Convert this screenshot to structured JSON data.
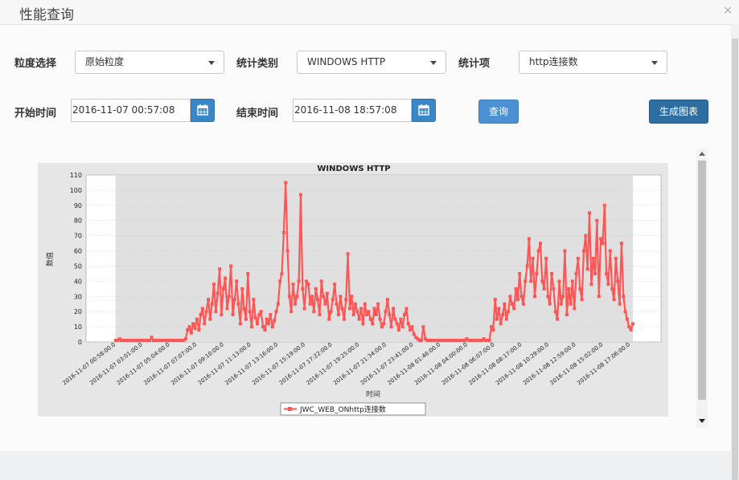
{
  "dialog": {
    "title": "性能查询",
    "close_glyph": "×"
  },
  "form": {
    "granularity_label": "粒度选择",
    "granularity_value": "原始粒度",
    "category_label": "统计类别",
    "category_value": "WINDOWS HTTP",
    "item_label": "统计项",
    "item_value": "http连接数",
    "start_label": "开始时间",
    "start_value": "2016-11-07 00:57:08",
    "end_label": "结束时间",
    "end_value": "2016-11-08 18:57:08",
    "query_button": "查询",
    "generate_button": "生成图表"
  },
  "icons": {
    "calendar": "calendar-icon",
    "dropdown": "chevron-down-icon",
    "close": "close-icon"
  },
  "colors": {
    "series": "#ff5555",
    "button_primary": "#4a90d2",
    "button_dark": "#2f6ea3",
    "calendar_button": "#3a87c8"
  },
  "chart_data": {
    "type": "line",
    "title": "WINDOWS HTTP",
    "xlabel": "时间",
    "ylabel": "数值",
    "ylim": [
      0,
      110
    ],
    "yticks": [
      0,
      10,
      20,
      30,
      40,
      50,
      60,
      70,
      80,
      90,
      100,
      110
    ],
    "xticks": [
      "2016-11-07 00:58:00.0",
      "2016-11-07 03:01:00.0",
      "2016-11-07 05:04:00.0",
      "2016-11-07 07:07:00.0",
      "2016-11-07 09:10:00.0",
      "2016-11-07 11:13:00.0",
      "2016-11-07 13:16:00.0",
      "2016-11-07 15:19:00.0",
      "2016-11-07 17:22:00.0",
      "2016-11-07 19:25:00.0",
      "2016-11-07 21:34:00.0",
      "2016-11-07 23:41:00.0",
      "2016-11-08 01:46:00.0",
      "2016-11-08 04:00:00.0",
      "2016-11-08 06:07:00.0",
      "2016-11-08 08:17:00.0",
      "2016-11-08 10:29:00.0",
      "2016-11-08 12:59:00.0",
      "2016-11-08 15:02:00.0",
      "2016-11-08 17:06:00.0"
    ],
    "grid": true,
    "legend_position": "bottom-center",
    "series": [
      {
        "name": "JWC_WEB_ONhttp连接数",
        "color": "#ff5555",
        "values": [
          1,
          1,
          2,
          1,
          1,
          1,
          1,
          1,
          1,
          1,
          1,
          1,
          1,
          1,
          1,
          1,
          1,
          1,
          1,
          3,
          1,
          1,
          1,
          1,
          1,
          1,
          1,
          1,
          1,
          1,
          1,
          1,
          1,
          1,
          1,
          1,
          1,
          2,
          8,
          10,
          6,
          12,
          9,
          15,
          8,
          18,
          22,
          12,
          20,
          28,
          15,
          25,
          38,
          20,
          32,
          48,
          18,
          35,
          42,
          22,
          30,
          50,
          18,
          28,
          40,
          25,
          12,
          35,
          22,
          15,
          45,
          20,
          10,
          28,
          16,
          12,
          18,
          20,
          10,
          8,
          15,
          12,
          18,
          10,
          14,
          20,
          25,
          40,
          45,
          72,
          105,
          60,
          30,
          20,
          38,
          25,
          30,
          40,
          97,
          35,
          22,
          40,
          38,
          25,
          30,
          20,
          35,
          28,
          18,
          40,
          30,
          25,
          32,
          15,
          20,
          28,
          38,
          25,
          18,
          30,
          22,
          15,
          28,
          58,
          22,
          30,
          18,
          25,
          20,
          15,
          22,
          12,
          25,
          18,
          20,
          15,
          12,
          22,
          18,
          25,
          15,
          10,
          12,
          20,
          28,
          18,
          10,
          22,
          15,
          12,
          8,
          15,
          10,
          18,
          22,
          12,
          8,
          10,
          5,
          3,
          2,
          1,
          1,
          10,
          2,
          1,
          1,
          1,
          1,
          1,
          1,
          1,
          1,
          1,
          1,
          1,
          1,
          1,
          1,
          1,
          1,
          1,
          1,
          1,
          1,
          1,
          2,
          1,
          1,
          1,
          1,
          1,
          1,
          1,
          1,
          2,
          1,
          1,
          1,
          10,
          8,
          28,
          15,
          22,
          12,
          18,
          25,
          15,
          20,
          30,
          25,
          22,
          35,
          28,
          45,
          30,
          25,
          40,
          50,
          68,
          40,
          55,
          30,
          45,
          60,
          65,
          40,
          35,
          55,
          30,
          25,
          45,
          35,
          20,
          15,
          40,
          25,
          30,
          60,
          18,
          35,
          25,
          40,
          22,
          45,
          55,
          35,
          28,
          60,
          70,
          48,
          85,
          38,
          55,
          45,
          80,
          30,
          68,
          65,
          90,
          45,
          38,
          60,
          35,
          28,
          55,
          40,
          25,
          65,
          30,
          20,
          15,
          10,
          8,
          12
        ],
        "marker": "square"
      }
    ]
  }
}
